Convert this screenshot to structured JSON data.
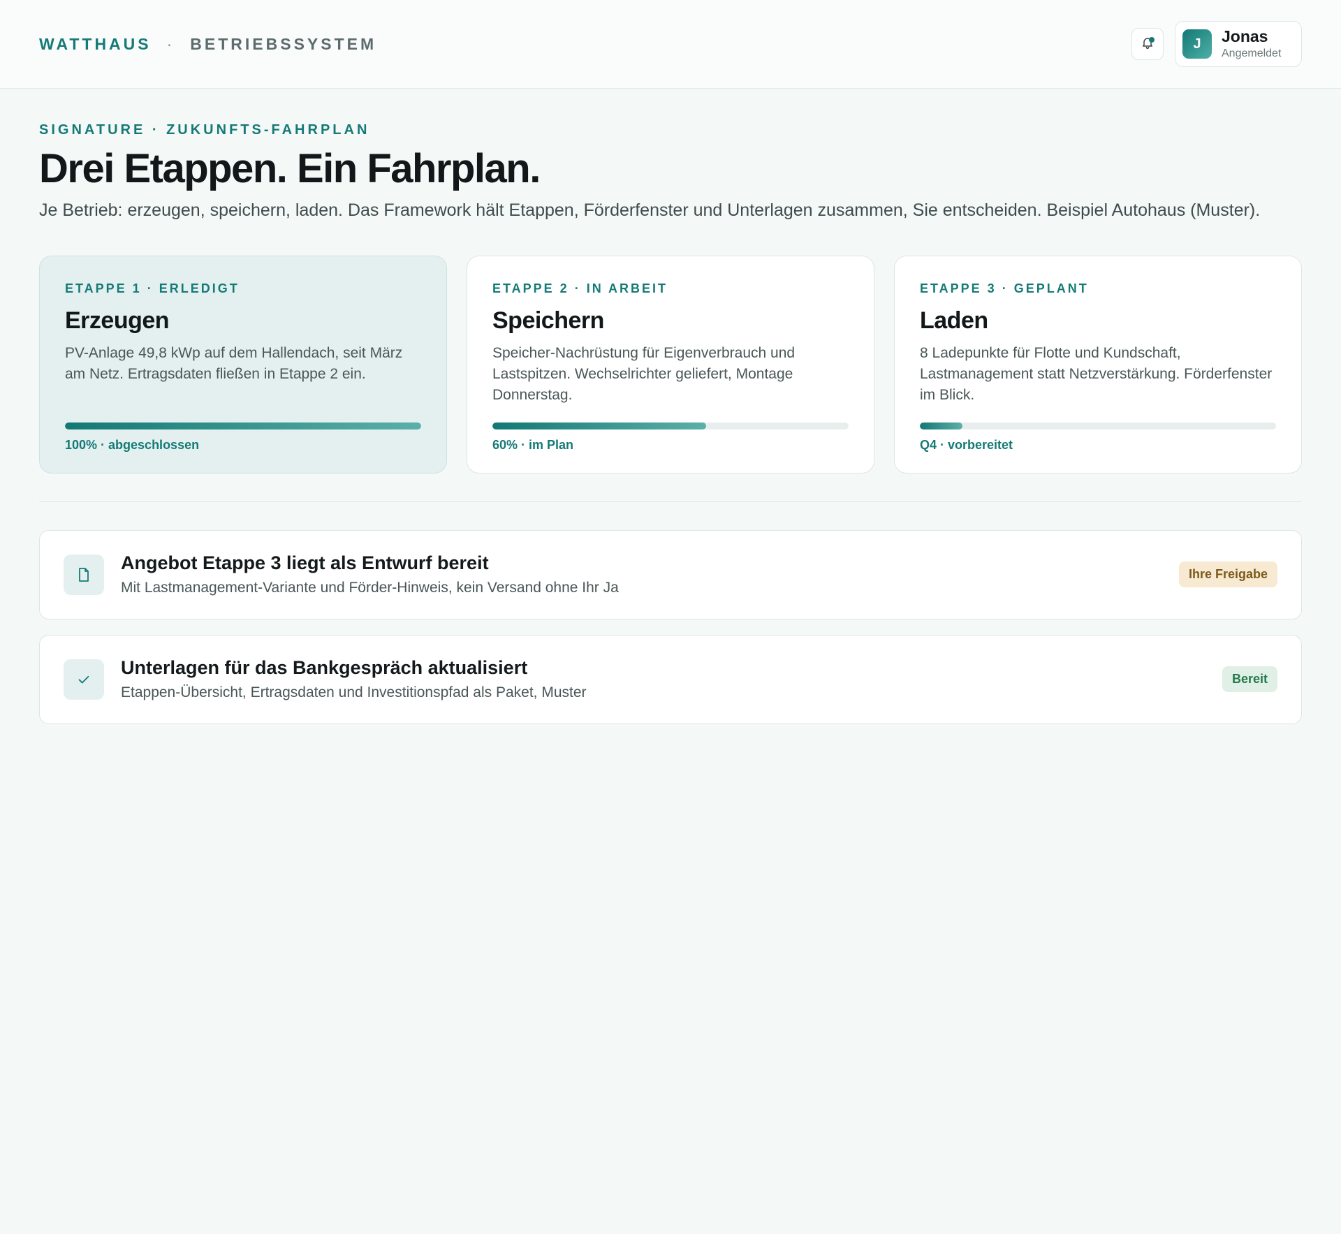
{
  "header": {
    "brand_name": "WATTHAUS",
    "brand_separator": "·",
    "brand_sub": "BETRIEBSSYSTEM",
    "bell_icon": "bell-icon",
    "user": {
      "initial": "J",
      "name": "Jonas",
      "status": "Angemeldet"
    }
  },
  "hero": {
    "eyebrow": "SIGNATURE · ZUKUNFTS-FAHRPLAN",
    "title": "Drei Etappen. Ein Fahrplan.",
    "lead": "Je Betrieb: erzeugen, speichern, laden. Das Framework hält Etappen, Förderfenster und Unterlagen zusammen, Sie entscheiden. Beispiel Autohaus (Muster)."
  },
  "stages": [
    {
      "tag": "ETAPPE 1 · ERLEDIGT",
      "title": "Erzeugen",
      "desc": "PV-Anlage 49,8 kWp auf dem Hallendach, seit März am Netz. Ertragsdaten fließen in Etappe 2 ein.",
      "progress": 1.0,
      "meta": "100% · abgeschlossen",
      "state": "done"
    },
    {
      "tag": "ETAPPE 2 · IN ARBEIT",
      "title": "Speichern",
      "desc": "Speicher-Nachrüstung für Eigenverbrauch und Lastspitzen. Wechselrichter geliefert, Montage Donnerstag.",
      "progress": 0.6,
      "meta": "60% · im Plan",
      "state": "active"
    },
    {
      "tag": "ETAPPE 3 · GEPLANT",
      "title": "Laden",
      "desc": "8 Ladepunkte für Flotte und Kundschaft, Lastmanagement statt Netzverstärkung. Förderfenster im Blick.",
      "progress": 0.12,
      "meta": "Q4 · vorbereitet",
      "state": "planned"
    }
  ],
  "tasks": [
    {
      "icon": "document-icon",
      "title": "Angebot Etappe 3 liegt als Entwurf bereit",
      "sub": "Mit Lastmanagement-Variante und Förder-Hinweis, kein Versand ohne Ihr Ja",
      "badge": "Ihre Freigabe",
      "badge_color": "#f8e9d2"
    },
    {
      "icon": "check-icon",
      "title": "Unterlagen für das Bankgespräch aktualisiert",
      "sub": "Etappen-Übersicht, Ertragsdaten und Investitionspfad als Paket, Muster",
      "badge": "Bereit",
      "badge_color": "#e0f0e6"
    }
  ],
  "colors": {
    "accent": "#157a76",
    "background": "#f4f8f7",
    "done_card": "#e3f0ef"
  }
}
